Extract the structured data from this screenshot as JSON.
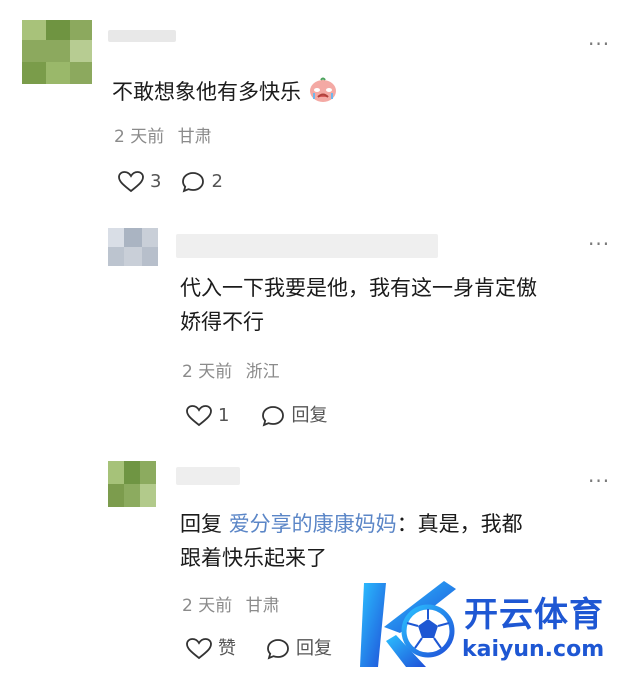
{
  "comments": [
    {
      "text": "不敢想象他有多快乐",
      "emoji": "crying-face-emoji",
      "time": "2 天前",
      "location": "甘肃",
      "likes": "3",
      "replies": "2"
    },
    {
      "text_line1": "代入一下我要是他，我有这一身肯定傲",
      "text_line2": "娇得不行",
      "time": "2 天前",
      "location": "浙江",
      "likes": "1",
      "reply_label": "回复"
    },
    {
      "reply_prefix": "回复",
      "mention": "爱分享的康康妈妈",
      "text_line1_rest": "：真是，我都",
      "text_line2": "跟着快乐起来了",
      "time": "2 天前",
      "location": "甘肃",
      "like_label": "赞",
      "reply_label": "回复"
    }
  ],
  "watermark": {
    "brand": "开云体育",
    "url": "kaiyun.com"
  },
  "colors": {
    "meta": "#8b8b8b",
    "mention": "#5b86c7",
    "brand": "#1e57d3"
  }
}
